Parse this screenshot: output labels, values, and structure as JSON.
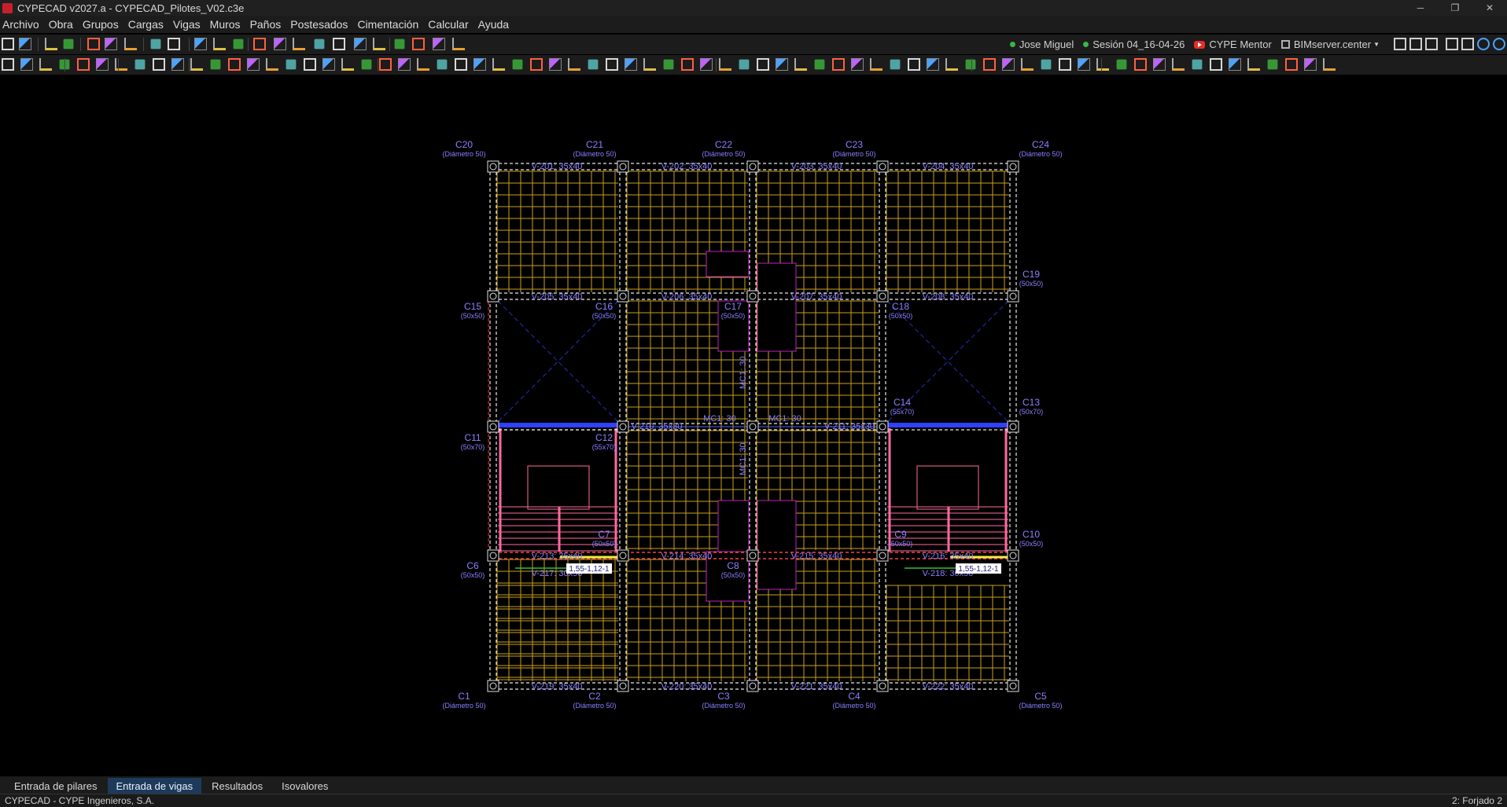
{
  "window": {
    "title": "CYPECAD v2027.a - CYPECAD_Pilotes_V02.c3e"
  },
  "menu": [
    "Archivo",
    "Obra",
    "Grupos",
    "Cargas",
    "Vigas",
    "Muros",
    "Paños",
    "Postesados",
    "Cimentación",
    "Calcular",
    "Ayuda"
  ],
  "header_right": {
    "user": "Jose Miguel",
    "session": "Sesión 04_16-04-26",
    "mentor": "CYPE Mentor",
    "bimserver": "BIMserver.center"
  },
  "tabs": [
    {
      "label": "Entrada de pilares",
      "active": false
    },
    {
      "label": "Entrada de vigas",
      "active": true
    },
    {
      "label": "Resultados",
      "active": false
    },
    {
      "label": "Isovalores",
      "active": false
    }
  ],
  "status": {
    "left": "CYPECAD - CYPE Ingenieros, S.A.",
    "right": "2: Forjado 2"
  },
  "colors": {
    "grid": "#c8a020",
    "beam_label": "#8a80ff",
    "column_label": "#8a80ff",
    "stair": "#ff6aa0",
    "red_dashed": "#ff3030",
    "green_beam": "#30c030"
  },
  "drawing": {
    "columns": [
      {
        "name": "C20",
        "section": "(Diámetro 50)"
      },
      {
        "name": "C21",
        "section": "(Diámetro 50)"
      },
      {
        "name": "C22",
        "section": "(Diámetro 50)"
      },
      {
        "name": "C23",
        "section": "(Diámetro 50)"
      },
      {
        "name": "C24",
        "section": "(Diámetro 50)"
      },
      {
        "name": "C19",
        "section": "(50x50)"
      },
      {
        "name": "C15",
        "section": "(50x50)"
      },
      {
        "name": "C16",
        "section": "(50x50)"
      },
      {
        "name": "C17",
        "section": "(50x50)"
      },
      {
        "name": "C18",
        "section": "(50x50)"
      },
      {
        "name": "C13",
        "section": "(50x70)"
      },
      {
        "name": "C14",
        "section": "(55x70)"
      },
      {
        "name": "C11",
        "section": "(50x70)"
      },
      {
        "name": "C12",
        "section": "(55x70)"
      },
      {
        "name": "C10",
        "section": "(50x50)"
      },
      {
        "name": "C6",
        "section": "(50x50)"
      },
      {
        "name": "C7",
        "section": "(50x50)"
      },
      {
        "name": "C8",
        "section": "(50x50)"
      },
      {
        "name": "C9",
        "section": "(50x50)"
      },
      {
        "name": "C1",
        "section": "(Diámetro 50)"
      },
      {
        "name": "C2",
        "section": "(Diámetro 50)"
      },
      {
        "name": "C3",
        "section": "(Diámetro 50)"
      },
      {
        "name": "C4",
        "section": "(Diámetro 50)"
      },
      {
        "name": "C5",
        "section": "(Diámetro 50)"
      }
    ],
    "beams_top": [
      "V-201: 35x40",
      "V-202: 35x40",
      "V-203: 35x40",
      "V-204: 35x40"
    ],
    "beams_row2": [
      "V-205: 35x40",
      "V-206: 35x40",
      "V-207: 35x40",
      "V-208: 35x40"
    ],
    "beams_mid": [
      "V-210: 35x30",
      "V-211: 35x30"
    ],
    "walls_mid": [
      "MC1: 30",
      "MC1: 30"
    ],
    "beams_row4": [
      "V-213: 35x40",
      "V-214: 35x40",
      "V-215: 35x40",
      "V-216: 35x40"
    ],
    "beams_row5": [
      "V-217: 30x50",
      "V-218: 30x50"
    ],
    "beams_bottom": [
      "V-219: 35x40",
      "V-220: 35x40",
      "V-221: 35x40",
      "V-222: 35x40"
    ],
    "stair_tags": [
      "1,55-1,12-1",
      "1,55-1,12-1"
    ]
  }
}
